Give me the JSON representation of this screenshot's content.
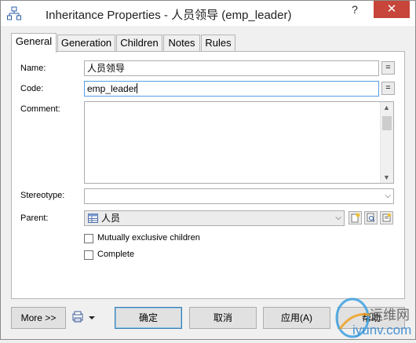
{
  "window": {
    "title": "Inheritance Properties - 人员领导 (emp_leader)",
    "help_button": "?",
    "close_button": "✕"
  },
  "tabs": [
    {
      "label": "General",
      "active": true
    },
    {
      "label": "Generation",
      "active": false
    },
    {
      "label": "Children",
      "active": false
    },
    {
      "label": "Notes",
      "active": false
    },
    {
      "label": "Rules",
      "active": false
    }
  ],
  "form": {
    "name_label": "Name:",
    "name_value": "人员领导",
    "code_label": "Code:",
    "code_value": "emp_leader",
    "comment_label": "Comment:",
    "comment_value": "",
    "stereotype_label": "Stereotype:",
    "stereotype_value": "",
    "parent_label": "Parent:",
    "parent_value": "人员",
    "equal_button": "=",
    "mutually_exclusive_label": "Mutually exclusive children",
    "mutually_exclusive_checked": false,
    "complete_label": "Complete",
    "complete_checked": false
  },
  "buttons": {
    "more": "More >>",
    "ok": "确定",
    "cancel": "取消",
    "apply": "应用(A)",
    "help": "帮助"
  },
  "watermark": {
    "line1": "运维网",
    "line2": "iyunv.com"
  },
  "colors": {
    "close_red": "#c7453a",
    "focus_blue": "#569de5",
    "default_button_border": "#3c7fb1"
  }
}
